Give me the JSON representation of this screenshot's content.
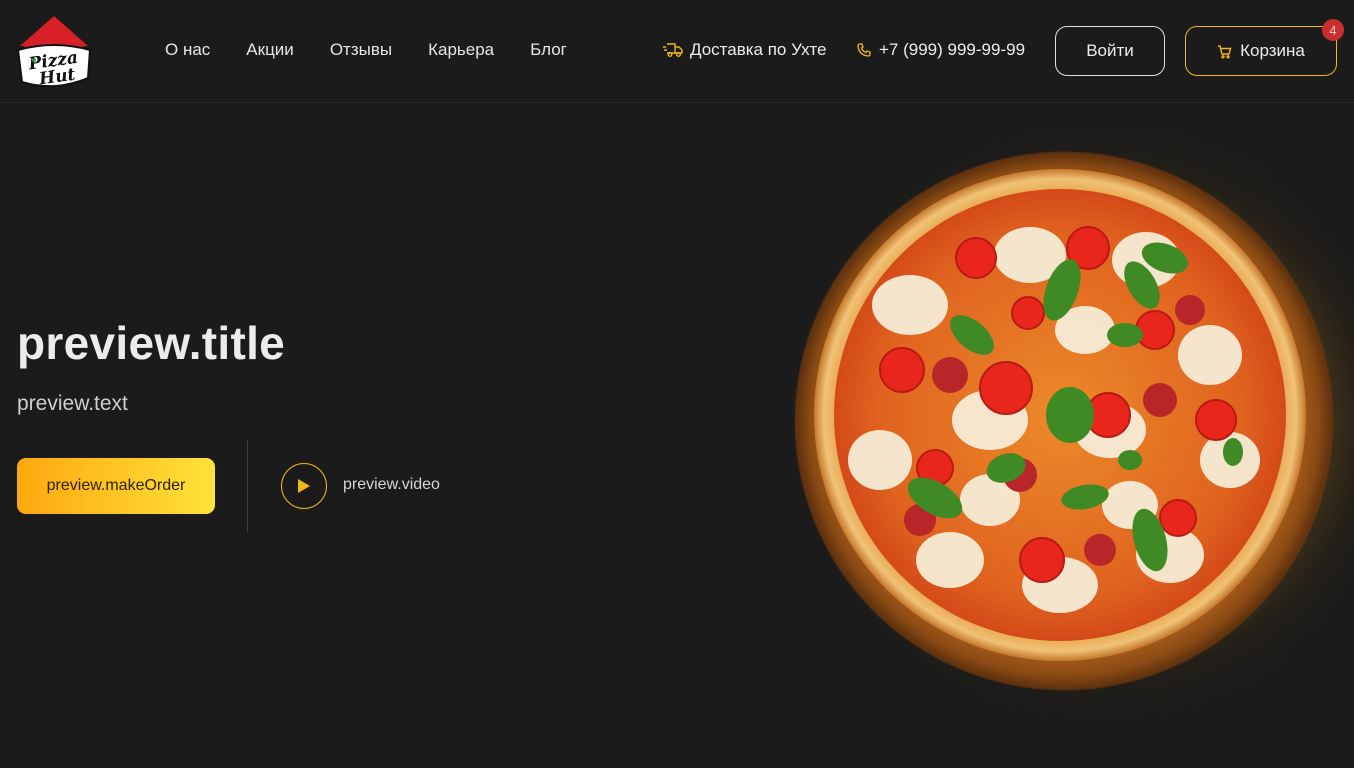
{
  "header": {
    "logo_text_line1": "Pizza",
    "logo_text_line2": "Hut",
    "nav": [
      {
        "label": "О нас"
      },
      {
        "label": "Акции"
      },
      {
        "label": "Отзывы"
      },
      {
        "label": "Карьера"
      },
      {
        "label": "Блог"
      }
    ],
    "delivery_label": "Доставка по Ухте",
    "delivery_icon": "delivery-truck-icon",
    "phone_label": "+7 (999) 999-99-99",
    "phone_icon": "phone-icon",
    "login_label": "Войти",
    "cart_label": "Корзина",
    "cart_icon": "shopping-cart-icon",
    "cart_count": "4"
  },
  "hero": {
    "title": "preview.title",
    "text": "preview.text",
    "order_label": "preview.makeOrder",
    "video_label": "preview.video",
    "play_icon": "play-icon",
    "image": "pizza-image"
  },
  "colors": {
    "background": "#1b1b1b",
    "accent": "#f2b51c",
    "badge": "#c8302f",
    "order_gradient_start": "#ffa80e",
    "order_gradient_end": "#ffe23a"
  }
}
